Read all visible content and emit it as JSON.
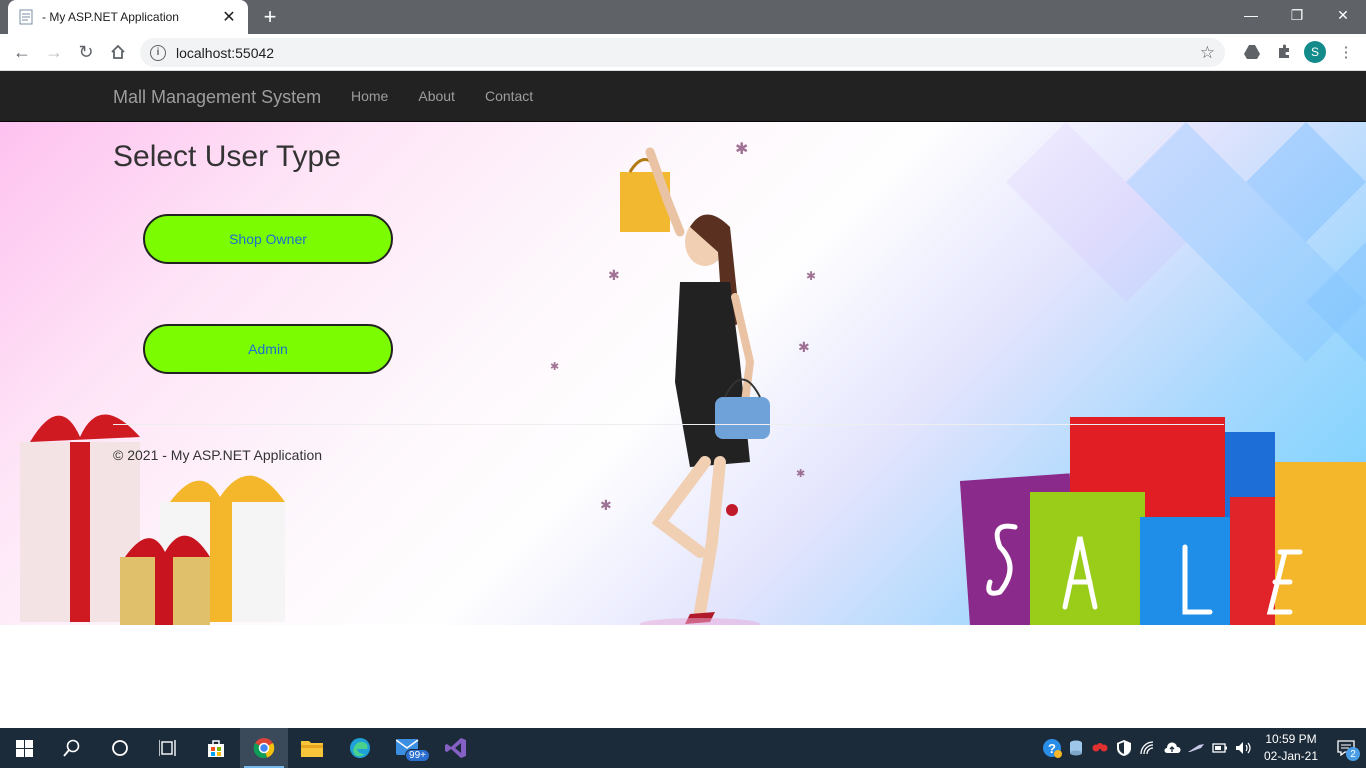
{
  "browser": {
    "tab_title": "- My ASP.NET Application",
    "url": "localhost:55042",
    "profile_initial": "S"
  },
  "site": {
    "brand": "Mall Management System",
    "nav": [
      "Home",
      "About",
      "Contact"
    ]
  },
  "main": {
    "heading": "Select User Type",
    "buttons": [
      "Shop Owner",
      "Admin"
    ]
  },
  "footer": {
    "text": "© 2021 - My ASP.NET Application"
  },
  "taskbar": {
    "mail_badge": "99+",
    "time": "10:59 PM",
    "date": "02-Jan-21",
    "notification_count": "2"
  },
  "colors": {
    "button_fill": "#7cfc00",
    "button_text": "#1a6fd0",
    "navbar_bg": "#222222"
  }
}
